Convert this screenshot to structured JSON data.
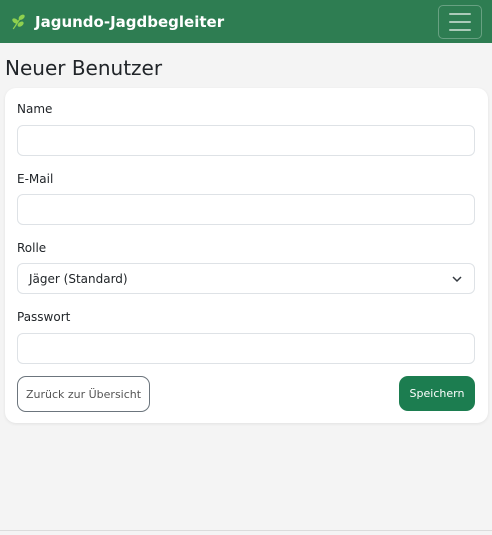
{
  "navbar": {
    "brand": "Jagundo-Jagdbegleiter",
    "brand_icon": "leaf-icon",
    "menu_icon": "hamburger-icon",
    "bg_color": "#2e7d52"
  },
  "page": {
    "title": "Neuer Benutzer"
  },
  "form": {
    "name_label": "Name",
    "name_value": "",
    "email_label": "E-Mail",
    "email_value": "",
    "role_label": "Rolle",
    "role_selected": "Jäger (Standard)",
    "password_label": "Passwort",
    "password_value": ""
  },
  "actions": {
    "back_label": "Zurück zur Übersicht",
    "save_label": "Speichern",
    "save_color": "#1c7d50"
  }
}
